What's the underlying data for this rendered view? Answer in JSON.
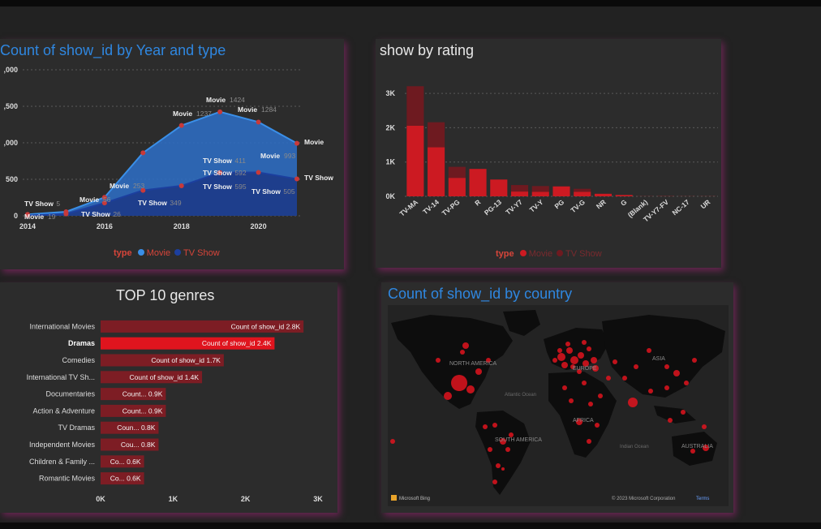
{
  "colors": {
    "movie_line": "#3a8fe8",
    "movie_area": "#2d6cc0",
    "tvshow_line": "#1c3f9e",
    "tvshow_area": "#1d3c8a",
    "rating_movie": "#cc1a22",
    "rating_tvshow": "#6e1a20",
    "genre_bar": "#7d1d24",
    "genre_bar_selected": "#e0141e",
    "map_dot": "#e0141e",
    "title_blue": "#2f87e0"
  },
  "panels": {
    "year_type": {
      "title": "Count of show_id by Year and type",
      "legend_title": "type",
      "legend_movie": "Movie",
      "legend_tvshow": "TV Show"
    },
    "rating": {
      "title": "show by rating",
      "legend_title": "type",
      "legend_movie": "Movie",
      "legend_tvshow": "TV Show"
    },
    "genres": {
      "title": "TOP 10 genres"
    },
    "country": {
      "title": "Count of show_id by country",
      "bing_label": "Microsoft Bing",
      "copyright": "© 2023 Microsoft Corporation",
      "terms": "Terms",
      "continents": [
        "NORTH AMERICA",
        "EUROPE",
        "ASIA",
        "AFRICA",
        "SOUTH AMERICA",
        "AUSTRALIA",
        "Atlantic Ocean",
        "Indian Ocean"
      ]
    }
  },
  "chart_data": [
    {
      "type": "area",
      "title": "Count of show_id by Year and type",
      "x": [
        2014,
        2015,
        2016,
        2017,
        2018,
        2019,
        2020,
        2021
      ],
      "x_ticks": [
        "2014",
        "2016",
        "2018",
        "2020"
      ],
      "y_ticks": [
        ",000",
        ",500",
        ",000",
        "500",
        "0"
      ],
      "ylim": [
        0,
        2000
      ],
      "series": [
        {
          "name": "Movie",
          "values": [
            19,
            56,
            253,
            863,
            1237,
            1424,
            1284,
            993
          ]
        },
        {
          "name": "TV Show",
          "values": [
            5,
            26,
            176,
            349,
            411,
            592,
            595,
            505
          ]
        }
      ],
      "data_labels": [
        {
          "series": "Movie",
          "text": "Movie",
          "value": "19"
        },
        {
          "series": "Movie",
          "text": "Movie",
          "value": "56"
        },
        {
          "series": "Movie",
          "text": "Movie",
          "value": "253"
        },
        {
          "series": "Movie",
          "text": "Movie",
          "value": "1237"
        },
        {
          "series": "Movie",
          "text": "Movie",
          "value": "1424"
        },
        {
          "series": "Movie",
          "text": "Movie",
          "value": "1284"
        },
        {
          "series": "Movie",
          "text": "Movie",
          "value": "993"
        },
        {
          "series": "Movie",
          "text": "Movie",
          "value": ""
        },
        {
          "series": "TV Show",
          "text": "TV Show",
          "value": "5"
        },
        {
          "series": "TV Show",
          "text": "TV Show",
          "value": "26"
        },
        {
          "series": "TV Show",
          "text": "TV Show",
          "value": "349"
        },
        {
          "series": "TV Show",
          "text": "TV Show",
          "value": "411"
        },
        {
          "series": "TV Show",
          "text": "TV Show",
          "value": "592"
        },
        {
          "series": "TV Show",
          "text": "TV Show",
          "value": "595"
        },
        {
          "series": "TV Show",
          "text": "TV Show",
          "value": "505"
        },
        {
          "series": "TV Show",
          "text": "TV Show",
          "value": ""
        }
      ],
      "legend": [
        "Movie",
        "TV Show"
      ]
    },
    {
      "type": "bar",
      "title": "show by rating",
      "categories": [
        "TV-MA",
        "TV-14",
        "TV-PG",
        "R",
        "PG-13",
        "TV-Y7",
        "TV-Y",
        "PG",
        "TV-G",
        "NR",
        "G",
        "(Blank)",
        "TV-Y7-FV",
        "NC-17",
        "UR"
      ],
      "series": [
        {
          "name": "Movie",
          "values": [
            2060,
            1430,
            540,
            800,
            490,
            140,
            130,
            290,
            130,
            75,
            40,
            3,
            5,
            3,
            3
          ]
        },
        {
          "name": "TV Show",
          "values": [
            1150,
            730,
            320,
            2,
            0,
            190,
            170,
            0,
            90,
            5,
            0,
            1,
            1,
            0,
            0
          ]
        }
      ],
      "y_ticks": [
        "3K",
        "2K",
        "1K",
        "0K"
      ],
      "ylim": [
        0,
        3500
      ],
      "stacked": true,
      "legend": [
        "Movie",
        "TV Show"
      ]
    },
    {
      "type": "bar",
      "orientation": "horizontal",
      "title": "TOP 10 genres",
      "categories": [
        "International Movies",
        "Dramas",
        "Comedies",
        "International TV Sh...",
        "Documentaries",
        "Action & Adventure",
        "TV Dramas",
        "Independent Movies",
        "Children & Family ...",
        "Romantic Movies"
      ],
      "values": [
        2800,
        2400,
        1700,
        1400,
        900,
        900,
        800,
        800,
        600,
        600
      ],
      "data_labels": [
        "Count of show_id 2.8K",
        "Count of show_id 2.4K",
        "Count of show_id 1.7K",
        "Count of show_id 1.4K",
        "Count... 0.9K",
        "Count... 0.9K",
        "Coun... 0.8K",
        "Cou... 0.8K",
        "Co... 0.6K",
        "Co... 0.6K"
      ],
      "selected_index": 1,
      "x_ticks": [
        "0K",
        "1K",
        "2K",
        "3K"
      ],
      "xlim": [
        0,
        3000
      ]
    }
  ]
}
